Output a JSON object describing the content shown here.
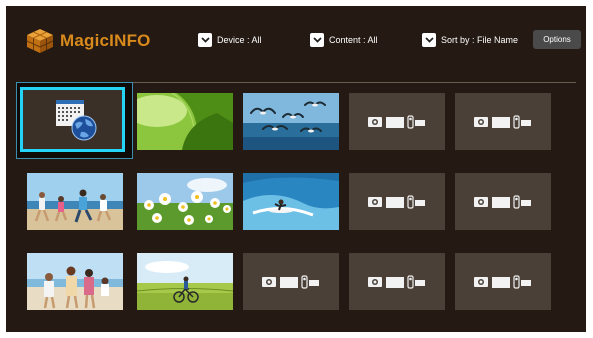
{
  "app": {
    "title": "MagicINFO",
    "logo_icon": "cube-icon",
    "brand_color": "#d98a1c"
  },
  "filters": [
    {
      "label": "Device : All",
      "icon": "chevron-down-icon"
    },
    {
      "label": "Content : All",
      "icon": "chevron-down-icon"
    },
    {
      "label": "Sort by : File Name",
      "icon": "chevron-down-icon"
    }
  ],
  "options_label": "Options",
  "selection_color": "#25d3f7",
  "grid": {
    "rows": [
      [
        {
          "type": "schedule",
          "icon": "calendar-globe-icon",
          "selected": true
        },
        {
          "type": "image",
          "subject": "green leaves"
        },
        {
          "type": "image",
          "subject": "seagulls over sea"
        },
        {
          "type": "placeholder",
          "icons": [
            "photo-icon",
            "video-icon",
            "music-icon"
          ]
        },
        {
          "type": "placeholder",
          "icons": [
            "photo-icon",
            "video-icon",
            "music-icon"
          ]
        }
      ],
      [
        {
          "type": "image",
          "subject": "family running on beach"
        },
        {
          "type": "image",
          "subject": "white daisies"
        },
        {
          "type": "image",
          "subject": "surfer on wave"
        },
        {
          "type": "placeholder",
          "icons": [
            "photo-icon",
            "video-icon",
            "music-icon"
          ]
        },
        {
          "type": "placeholder",
          "icons": [
            "photo-icon",
            "video-icon",
            "music-icon"
          ]
        }
      ],
      [
        {
          "type": "image",
          "subject": "family on beach"
        },
        {
          "type": "image",
          "subject": "cyclist in field"
        },
        {
          "type": "placeholder",
          "icons": [
            "photo-icon",
            "video-icon",
            "music-icon"
          ]
        },
        {
          "type": "placeholder",
          "icons": [
            "photo-icon",
            "video-icon",
            "music-icon"
          ]
        },
        {
          "type": "placeholder",
          "icons": [
            "photo-icon",
            "video-icon",
            "music-icon"
          ]
        }
      ]
    ]
  }
}
